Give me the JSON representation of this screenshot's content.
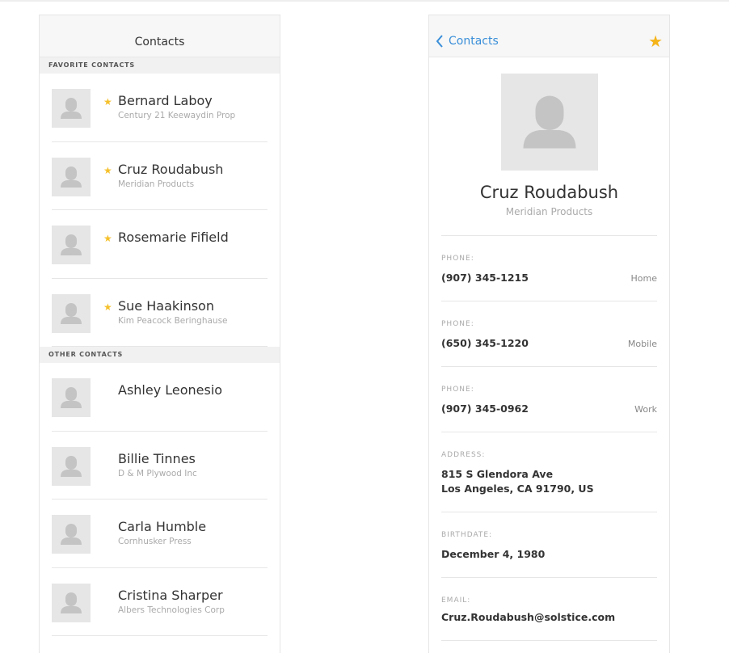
{
  "list": {
    "title": "Contacts",
    "favorites_header": "FAVORITE CONTACTS",
    "others_header": "OTHER CONTACTS",
    "favorites": [
      {
        "name": "Bernard Laboy",
        "company": "Century 21 Keewaydin Prop"
      },
      {
        "name": "Cruz Roudabush",
        "company": "Meridian Products"
      },
      {
        "name": "Rosemarie Fifield",
        "company": ""
      },
      {
        "name": "Sue Haakinson",
        "company": "Kim Peacock Beringhause"
      }
    ],
    "others": [
      {
        "name": "Ashley Leonesio",
        "company": ""
      },
      {
        "name": "Billie Tinnes",
        "company": "D & M Plywood Inc"
      },
      {
        "name": "Carla Humble",
        "company": "Cornhusker Press"
      },
      {
        "name": "Cristina Sharper",
        "company": "Albers Technologies Corp"
      }
    ]
  },
  "detail": {
    "back_label": "Contacts",
    "name": "Cruz Roudabush",
    "company": "Meridian Products",
    "phones": [
      {
        "label": "PHONE:",
        "value": "(907) 345-1215",
        "type": "Home"
      },
      {
        "label": "PHONE:",
        "value": "(650) 345-1220",
        "type": "Mobile"
      },
      {
        "label": "PHONE:",
        "value": "(907) 345-0962",
        "type": "Work"
      }
    ],
    "address_label": "ADDRESS:",
    "address_line1": "815 S Glendora Ave",
    "address_line2": "Los Angeles, CA 91790, US",
    "birthdate_label": "BIRTHDATE:",
    "birthdate": "December 4, 1980",
    "email_label": "EMAIL:",
    "email": "Cruz.Roudabush@solstice.com"
  },
  "colors": {
    "accent": "#3b8fd9",
    "star": "#f5b41a"
  }
}
